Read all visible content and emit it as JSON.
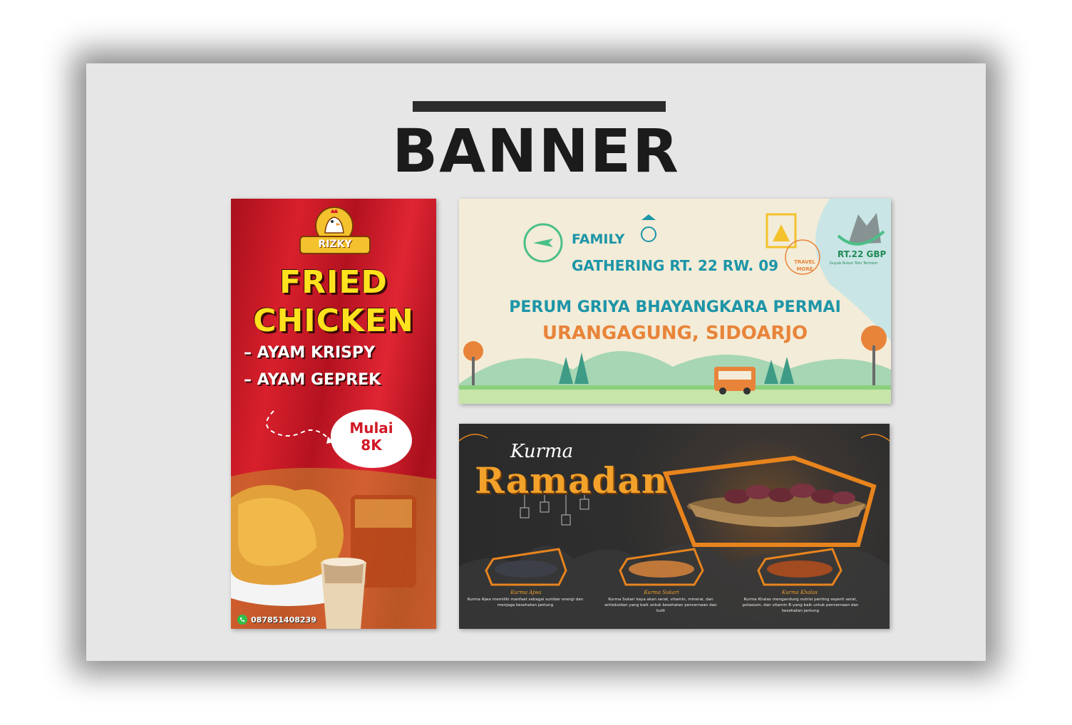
{
  "page": {
    "title": "BANNER"
  },
  "fried_chicken": {
    "brand": "RIZKY",
    "title_line1": "FRIED",
    "title_line2": "CHICKEN",
    "menu": [
      "– AYAM KRISPY",
      "– AYAM GEPREK"
    ],
    "price_line1": "Mulai",
    "price_line2": "8K",
    "phone": "087851408239",
    "colors": {
      "background": "#c81a27",
      "title": "#ffe21d",
      "price_text": "#d01a26"
    }
  },
  "family_gathering": {
    "line1": "FAMILY",
    "line2": "GATHERING RT. 22 RW. 09",
    "line3": "PERUM GRIYA BHAYANGKARA PERMAI",
    "line4": "URANGAGUNG, SIDOARJO",
    "badge_text": "TRAVEL MORE",
    "logo_title": "RT.22 GBP",
    "logo_subtitle": "Guyub Rukun Toto Tentrem",
    "colors": {
      "background": "#f3ecd8",
      "primary": "#1d95a8",
      "accent": "#e8843a"
    }
  },
  "kurma_ramadan": {
    "title_small": "Kurma",
    "title_large": "Ramadan",
    "products": [
      {
        "name": "Kurma Ajwa",
        "description": "Kurma Ajwa memiliki manfaat sebagai sumber energi dan menjaga kesehatan jantung"
      },
      {
        "name": "Kurma Sukari",
        "description": "Kurma Sukari kaya akan serat, vitamin, mineral, dan antioksidan yang baik untuk kesehatan pencernaan dan kulit"
      },
      {
        "name": "Kurma Khalas",
        "description": "Kurma Khalas mengandung nutrisi penting seperti serat, potasium, dan vitamin B yang baik untuk pencernaan dan kesehatan jantung"
      }
    ],
    "colors": {
      "background": "#2a2a2a",
      "title": "#f2a12a"
    }
  }
}
